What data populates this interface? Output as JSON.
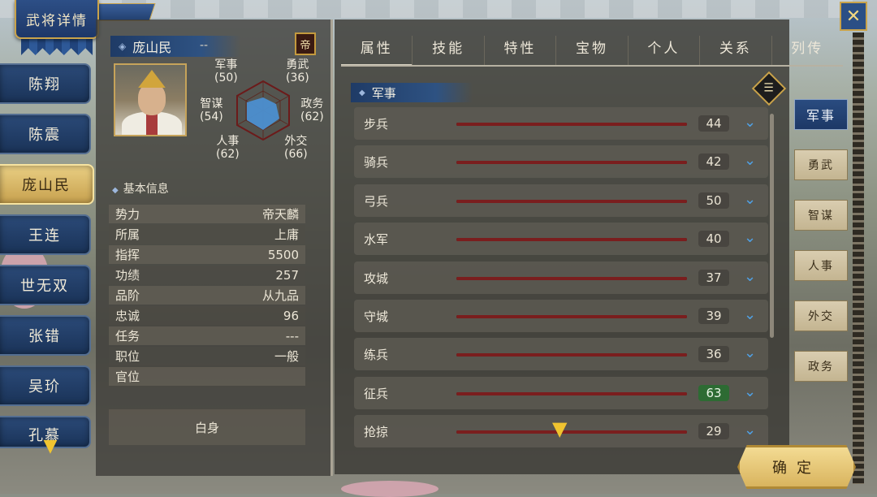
{
  "title": "武将详情",
  "generals": [
    {
      "label": "陈翔",
      "active": false
    },
    {
      "label": "陈震",
      "active": false
    },
    {
      "label": "庞山民",
      "active": true
    },
    {
      "label": "王连",
      "active": false
    },
    {
      "label": "世无双",
      "active": false
    },
    {
      "label": "张错",
      "active": false
    },
    {
      "label": "吴玠",
      "active": false
    },
    {
      "label": "孔慕",
      "active": false
    }
  ],
  "profile": {
    "name": "庞山民",
    "suffix": "--",
    "emperor_badge": "帝",
    "stats": {
      "military": {
        "label": "军事",
        "value": "(50)"
      },
      "valor": {
        "label": "勇武",
        "value": "(36)"
      },
      "strategy": {
        "label": "智谋",
        "value": "(54)"
      },
      "politics": {
        "label": "政务",
        "value": "(62)"
      },
      "personnel": {
        "label": "人事",
        "value": "(62)"
      },
      "diplomacy": {
        "label": "外交",
        "value": "(66)"
      }
    }
  },
  "basic_info": {
    "header": "基本信息",
    "rows": [
      {
        "label": "势力",
        "value": "帝天麟"
      },
      {
        "label": "所属",
        "value": "上庸"
      },
      {
        "label": "指挥",
        "value": "5500"
      },
      {
        "label": "功绩",
        "value": "257"
      },
      {
        "label": "品阶",
        "value": "从九品"
      },
      {
        "label": "忠诚",
        "value": "96"
      },
      {
        "label": "任务",
        "value": "---"
      },
      {
        "label": "职位",
        "value": "一般"
      },
      {
        "label": "官位",
        "value": ""
      }
    ],
    "status": "白身"
  },
  "tabs": [
    "属性",
    "技能",
    "特性",
    "宝物",
    "个人",
    "关系",
    "列传"
  ],
  "section": "军事",
  "skills": [
    {
      "name": "步兵",
      "value": "44",
      "highlight": false
    },
    {
      "name": "骑兵",
      "value": "42",
      "highlight": false
    },
    {
      "name": "弓兵",
      "value": "50",
      "highlight": false
    },
    {
      "name": "水军",
      "value": "40",
      "highlight": false
    },
    {
      "name": "攻城",
      "value": "37",
      "highlight": false
    },
    {
      "name": "守城",
      "value": "39",
      "highlight": false
    },
    {
      "name": "练兵",
      "value": "36",
      "highlight": false
    },
    {
      "name": "征兵",
      "value": "63",
      "highlight": true
    },
    {
      "name": "抢掠",
      "value": "29",
      "highlight": false
    }
  ],
  "categories": [
    {
      "label": "军事",
      "active": true
    },
    {
      "label": "勇武",
      "active": false
    },
    {
      "label": "智谋",
      "active": false
    },
    {
      "label": "人事",
      "active": false
    },
    {
      "label": "外交",
      "active": false
    },
    {
      "label": "政务",
      "active": false
    }
  ],
  "confirm_label": "确定",
  "icons": {
    "close": "crossed-swords-icon",
    "list": "list-icon",
    "scroll_down": "chevron-down-icon"
  },
  "colors": {
    "accent_gold": "#c9a34b",
    "panel_blue": "#2b4a78",
    "highlight_green": "#2d6b33",
    "bar_red": "#7a1e1e"
  }
}
